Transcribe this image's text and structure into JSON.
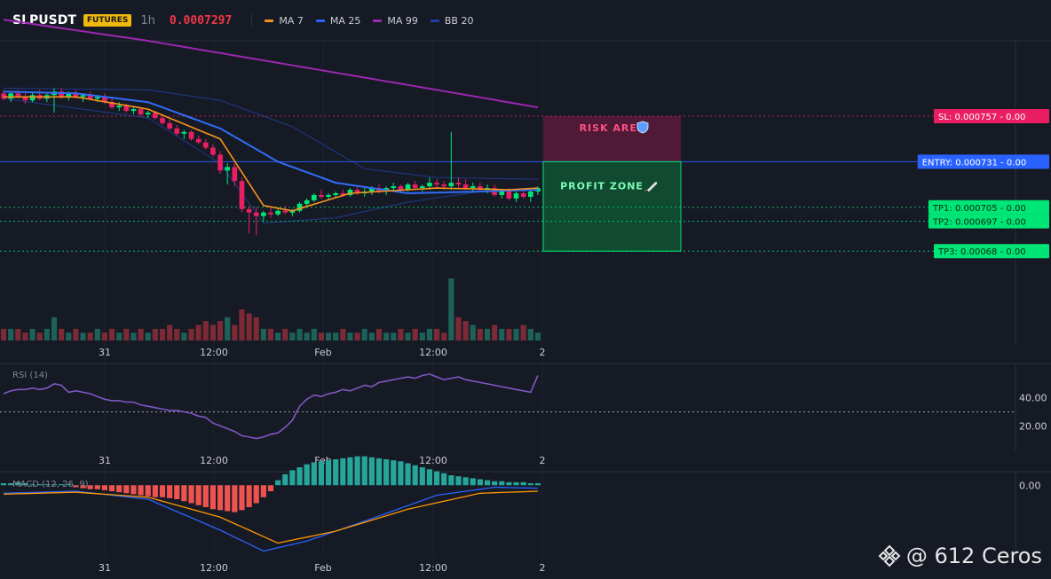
{
  "header": {
    "symbol": "SLPUSDT",
    "badge": "FUTURES",
    "interval": "1h",
    "last_price": "0.0007297",
    "legend": [
      {
        "label": "MA 7",
        "color": "#f7931a"
      },
      {
        "label": "MA 25",
        "color": "#2962ff"
      },
      {
        "label": "MA 99",
        "color": "#9c27b0"
      },
      {
        "label": "BB 20",
        "color": "#1e40af"
      }
    ]
  },
  "panes": {
    "rsi_label": "RSI (14)",
    "macd_label": "MACD (12, 26, 9)"
  },
  "annotations": {
    "risk_label": "RISK AREA",
    "profit_label": "PROFIT ZONE",
    "risk_icon": "shield-icon",
    "profit_icon": "rocket-icon"
  },
  "watermark": "@ 612 Ceros",
  "colors": {
    "bg": "#161a25",
    "up": "#26a69a",
    "down": "#ef5350",
    "sl": "#e91e63",
    "entry": "#2962ff",
    "tp": "#00e676",
    "rsi": "#7e57c2",
    "macd": "#2962ff",
    "signal": "#ff9800"
  },
  "chart_data": [
    {
      "type": "candlestick",
      "title": "SLPUSDT 1h",
      "x_ticks": [
        "31",
        "12:00",
        "Feb",
        "12:00",
        "2"
      ],
      "ylim": [
        0.000627,
        0.0008
      ],
      "candles": [
        [
          0.00077,
          0.000772,
          0.000766,
          0.000767
        ],
        [
          0.000767,
          0.000771,
          0.000765,
          0.00077
        ],
        [
          0.00077,
          0.000772,
          0.000767,
          0.000768
        ],
        [
          0.000768,
          0.00077,
          0.000764,
          0.000766
        ],
        [
          0.000766,
          0.000771,
          0.000765,
          0.000769
        ],
        [
          0.000769,
          0.000772,
          0.000766,
          0.000767
        ],
        [
          0.000767,
          0.00077,
          0.000765,
          0.000769
        ],
        [
          0.000769,
          0.000773,
          0.000759,
          0.000771
        ],
        [
          0.000771,
          0.000773,
          0.000767,
          0.000768
        ],
        [
          0.000768,
          0.000771,
          0.000766,
          0.00077
        ],
        [
          0.00077,
          0.000772,
          0.000767,
          0.000768
        ],
        [
          0.000768,
          0.00077,
          0.000765,
          0.000769
        ],
        [
          0.000769,
          0.000771,
          0.000766,
          0.000767
        ],
        [
          0.000767,
          0.000769,
          0.000765,
          0.000768
        ],
        [
          0.000768,
          0.00077,
          0.000764,
          0.000765
        ],
        [
          0.000765,
          0.000767,
          0.000761,
          0.000762
        ],
        [
          0.000762,
          0.000765,
          0.00076,
          0.000763
        ],
        [
          0.000763,
          0.000764,
          0.000759,
          0.00076
        ],
        [
          0.00076,
          0.000762,
          0.000758,
          0.000761
        ],
        [
          0.000761,
          0.000762,
          0.000757,
          0.000758
        ],
        [
          0.000758,
          0.00076,
          0.000756,
          0.000759
        ],
        [
          0.000759,
          0.00076,
          0.000755,
          0.000756
        ],
        [
          0.000756,
          0.000758,
          0.000752,
          0.000753
        ],
        [
          0.000753,
          0.000755,
          0.000749,
          0.00075
        ],
        [
          0.00075,
          0.000752,
          0.000746,
          0.000747
        ],
        [
          0.000747,
          0.000749,
          0.000744,
          0.000748
        ],
        [
          0.000748,
          0.000749,
          0.000743,
          0.000744
        ],
        [
          0.000744,
          0.000746,
          0.000741,
          0.000742
        ],
        [
          0.000742,
          0.000744,
          0.000738,
          0.000739
        ],
        [
          0.000739,
          0.000741,
          0.000734,
          0.000735
        ],
        [
          0.000735,
          0.000737,
          0.000724,
          0.000726
        ],
        [
          0.000726,
          0.00073,
          0.000718,
          0.000728
        ],
        [
          0.000728,
          0.00073,
          0.000717,
          0.00072
        ],
        [
          0.00072,
          0.000722,
          0.000702,
          0.000704
        ],
        [
          0.000704,
          0.000706,
          0.00069,
          0.000702
        ],
        [
          0.000702,
          0.000705,
          0.000689,
          0.0007
        ],
        [
          0.0007,
          0.000703,
          0.000697,
          0.000702
        ],
        [
          0.000702,
          0.000705,
          0.000699,
          0.000701
        ],
        [
          0.000701,
          0.000704,
          0.0007,
          0.000703
        ],
        [
          0.000703,
          0.000706,
          0.000701,
          0.000702
        ],
        [
          0.000702,
          0.000704,
          0.0007,
          0.000703
        ],
        [
          0.000703,
          0.000708,
          0.000702,
          0.000707
        ],
        [
          0.000707,
          0.00071,
          0.000705,
          0.000709
        ],
        [
          0.000709,
          0.000713,
          0.000708,
          0.000712
        ],
        [
          0.000712,
          0.000715,
          0.00071,
          0.000711
        ],
        [
          0.000711,
          0.000713,
          0.000709,
          0.000712
        ],
        [
          0.000712,
          0.000714,
          0.00071,
          0.000713
        ],
        [
          0.000713,
          0.000715,
          0.000711,
          0.000712
        ],
        [
          0.000712,
          0.000716,
          0.000711,
          0.000715
        ],
        [
          0.000715,
          0.000717,
          0.000712,
          0.000713
        ],
        [
          0.000713,
          0.000716,
          0.000711,
          0.000714
        ],
        [
          0.000714,
          0.000717,
          0.000712,
          0.000716
        ],
        [
          0.000716,
          0.000718,
          0.000713,
          0.000714
        ],
        [
          0.000714,
          0.000717,
          0.000712,
          0.000716
        ],
        [
          0.000716,
          0.000719,
          0.000714,
          0.000717
        ],
        [
          0.000717,
          0.000718,
          0.000713,
          0.000715
        ],
        [
          0.000715,
          0.000719,
          0.000714,
          0.000718
        ],
        [
          0.000718,
          0.00072,
          0.000715,
          0.000716
        ],
        [
          0.000716,
          0.000718,
          0.000714,
          0.000717
        ],
        [
          0.000717,
          0.000722,
          0.000715,
          0.000719
        ],
        [
          0.000719,
          0.000721,
          0.000716,
          0.000718
        ],
        [
          0.000718,
          0.00072,
          0.000715,
          0.000717
        ],
        [
          0.000717,
          0.000748,
          0.000715,
          0.000719
        ],
        [
          0.000719,
          0.000722,
          0.000716,
          0.000718
        ],
        [
          0.000718,
          0.000721,
          0.000715,
          0.000716
        ],
        [
          0.000716,
          0.000719,
          0.000714,
          0.000717
        ],
        [
          0.000717,
          0.000719,
          0.000714,
          0.000715
        ],
        [
          0.000715,
          0.000718,
          0.000713,
          0.000716
        ],
        [
          0.000716,
          0.000718,
          0.000711,
          0.000712
        ],
        [
          0.000712,
          0.000715,
          0.00071,
          0.000714
        ],
        [
          0.000714,
          0.000716,
          0.000709,
          0.00071
        ],
        [
          0.00071,
          0.000714,
          0.000708,
          0.000713
        ],
        [
          0.000713,
          0.000716,
          0.00071,
          0.000711
        ],
        [
          0.000711,
          0.000715,
          0.000708,
          0.000714
        ],
        [
          0.000714,
          0.000717,
          0.000712,
          0.000716
        ]
      ],
      "volume": [
        3,
        3,
        3,
        2,
        3,
        2,
        3,
        6,
        3,
        2,
        3,
        2,
        2,
        3,
        2,
        3,
        2,
        3,
        2,
        3,
        2,
        3,
        3,
        4,
        3,
        2,
        3,
        4,
        5,
        4,
        5,
        6,
        4,
        8,
        7,
        6,
        3,
        3,
        2,
        3,
        2,
        3,
        2,
        3,
        2,
        2,
        2,
        3,
        2,
        2,
        3,
        2,
        3,
        2,
        2,
        3,
        2,
        3,
        2,
        3,
        3,
        2,
        16,
        6,
        5,
        4,
        3,
        3,
        4,
        3,
        3,
        3,
        4,
        3,
        2
      ],
      "ma7_anchor": [
        [
          0,
          0.000768
        ],
        [
          10,
          0.000768
        ],
        [
          20,
          0.000761
        ],
        [
          30,
          0.000744
        ],
        [
          36,
          0.000706
        ],
        [
          40,
          0.000703
        ],
        [
          48,
          0.000713
        ],
        [
          60,
          0.000716
        ],
        [
          70,
          0.000715
        ],
        [
          74,
          0.000716
        ]
      ],
      "ma25_anchor": [
        [
          0,
          0.000771
        ],
        [
          10,
          0.00077
        ],
        [
          20,
          0.000765
        ],
        [
          30,
          0.00075
        ],
        [
          38,
          0.000731
        ],
        [
          46,
          0.000719
        ],
        [
          56,
          0.000713
        ],
        [
          66,
          0.000714
        ],
        [
          74,
          0.000715
        ]
      ],
      "ma99_anchor": [
        [
          0,
          0.000812
        ],
        [
          20,
          0.0008
        ],
        [
          40,
          0.000786
        ],
        [
          60,
          0.000772
        ],
        [
          74,
          0.000762
        ]
      ],
      "bb_upper_anchor": [
        [
          0,
          0.000773
        ],
        [
          20,
          0.000772
        ],
        [
          30,
          0.000766
        ],
        [
          40,
          0.000751
        ],
        [
          50,
          0.000727
        ],
        [
          60,
          0.000722
        ],
        [
          74,
          0.000721
        ]
      ],
      "bb_lower_anchor": [
        [
          0,
          0.000767
        ],
        [
          20,
          0.000756
        ],
        [
          30,
          0.00073
        ],
        [
          36,
          0.000696
        ],
        [
          46,
          0.000699
        ],
        [
          56,
          0.000708
        ],
        [
          66,
          0.000714
        ],
        [
          74,
          0.000715
        ]
      ],
      "levels": [
        {
          "label": "SL: 0.000757",
          "value": 0.000757,
          "pnl": "- 0.00",
          "color": "#e91e63"
        },
        {
          "label": "ENTRY: 0.000731",
          "value": 0.000731,
          "pnl": "- 0.00",
          "color": "#2962ff"
        },
        {
          "label": "TP1: 0.000705",
          "value": 0.000705,
          "pnl": "- 0.00",
          "color": "#00e676"
        },
        {
          "label": "TP2: 0.000697",
          "value": 0.000697,
          "pnl": "- 0.00",
          "color": "#00e676"
        },
        {
          "label": "TP3: 0.00068",
          "value": 0.00068,
          "pnl": "- 0.00",
          "color": "#00e676"
        }
      ]
    },
    {
      "type": "line",
      "title": "RSI (14)",
      "y_ticks": [
        "40.00",
        "20.00"
      ],
      "ylim": [
        5,
        62
      ],
      "guide_level": 30,
      "values": [
        43,
        45,
        46,
        46,
        47,
        46,
        47,
        50,
        49,
        44,
        45,
        44,
        43,
        41,
        39,
        38,
        38,
        37,
        37,
        35,
        34,
        33,
        32,
        31,
        31,
        30,
        29,
        27,
        26,
        22,
        20,
        18,
        16,
        13,
        12,
        11,
        12,
        14,
        15,
        19,
        24,
        34,
        39,
        42,
        41,
        43,
        44,
        46,
        45,
        47,
        49,
        48,
        51,
        52,
        53,
        54,
        55,
        54,
        56,
        57,
        55,
        53,
        54,
        55,
        53,
        52,
        51,
        50,
        49,
        48,
        47,
        46,
        45,
        44,
        56
      ]
    },
    {
      "type": "bar",
      "title": "MACD (12, 26, 9)",
      "y_ticks": [
        "0.00"
      ],
      "hist": [
        0.2,
        0.2,
        0.3,
        0.2,
        0.1,
        0.1,
        0.1,
        0.1,
        0.1,
        0.1,
        -0.2,
        -0.3,
        -0.4,
        -0.4,
        -0.5,
        -0.6,
        -0.7,
        -0.8,
        -0.9,
        -1.0,
        -1.1,
        -1.2,
        -1.2,
        -1.3,
        -1.4,
        -1.6,
        -1.8,
        -2.0,
        -2.2,
        -2.4,
        -2.5,
        -2.6,
        -2.7,
        -2.5,
        -2.2,
        -1.8,
        -1.2,
        -0.6,
        0.5,
        1.1,
        1.5,
        1.8,
        2.1,
        2.3,
        2.4,
        2.5,
        2.6,
        2.7,
        2.8,
        2.9,
        2.9,
        2.8,
        2.7,
        2.6,
        2.5,
        2.4,
        2.2,
        2.0,
        1.8,
        1.6,
        1.4,
        1.2,
        1.0,
        0.9,
        0.8,
        0.7,
        0.6,
        0.5,
        0.4,
        0.4,
        0.3,
        0.3,
        0.3,
        0.2,
        0.2
      ],
      "macd_anchor": [
        [
          0,
          -0.8
        ],
        [
          10,
          -0.6
        ],
        [
          20,
          -1.4
        ],
        [
          30,
          -4.5
        ],
        [
          36,
          -6.6
        ],
        [
          42,
          -5.6
        ],
        [
          50,
          -3.6
        ],
        [
          60,
          -1.0
        ],
        [
          68,
          -0.2
        ],
        [
          74,
          -0.3
        ]
      ],
      "signal_anchor": [
        [
          0,
          -0.9
        ],
        [
          10,
          -0.7
        ],
        [
          20,
          -1.2
        ],
        [
          30,
          -3.2
        ],
        [
          38,
          -5.8
        ],
        [
          46,
          -4.6
        ],
        [
          56,
          -2.4
        ],
        [
          66,
          -0.8
        ],
        [
          74,
          -0.6
        ]
      ],
      "ylim": [
        -7,
        1
      ]
    }
  ]
}
